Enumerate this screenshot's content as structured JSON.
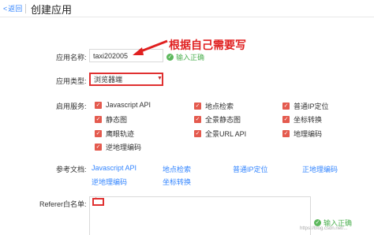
{
  "topbar": {
    "back_label": "返回",
    "title": "创建应用"
  },
  "app_name": {
    "label": "应用名称:",
    "value": "taxi202005",
    "status": "输入正确"
  },
  "annotation": {
    "text": "根据自己需要写"
  },
  "app_type": {
    "label": "应用类型:",
    "value": "浏览器端"
  },
  "services": {
    "label": "启用服务:",
    "col1": [
      "Javascript API",
      "静态图",
      "鹰眼轨迹",
      "逆地理编码"
    ],
    "col2": [
      "地点检索",
      "全景静态图",
      "全景URL API"
    ],
    "col3": [
      "普通IP定位",
      "坐标转换",
      "地理编码"
    ]
  },
  "references": {
    "label": "参考文档:",
    "row1": [
      "Javascript API",
      "地点检索",
      "普通IP定位",
      "正地理编码"
    ],
    "row2": [
      "逆地理编码",
      "坐标转换"
    ]
  },
  "referer": {
    "label": "Referer白名单:",
    "value": "*",
    "status": "输入正确"
  },
  "watermark": "https://blog.csdn.net/..."
}
